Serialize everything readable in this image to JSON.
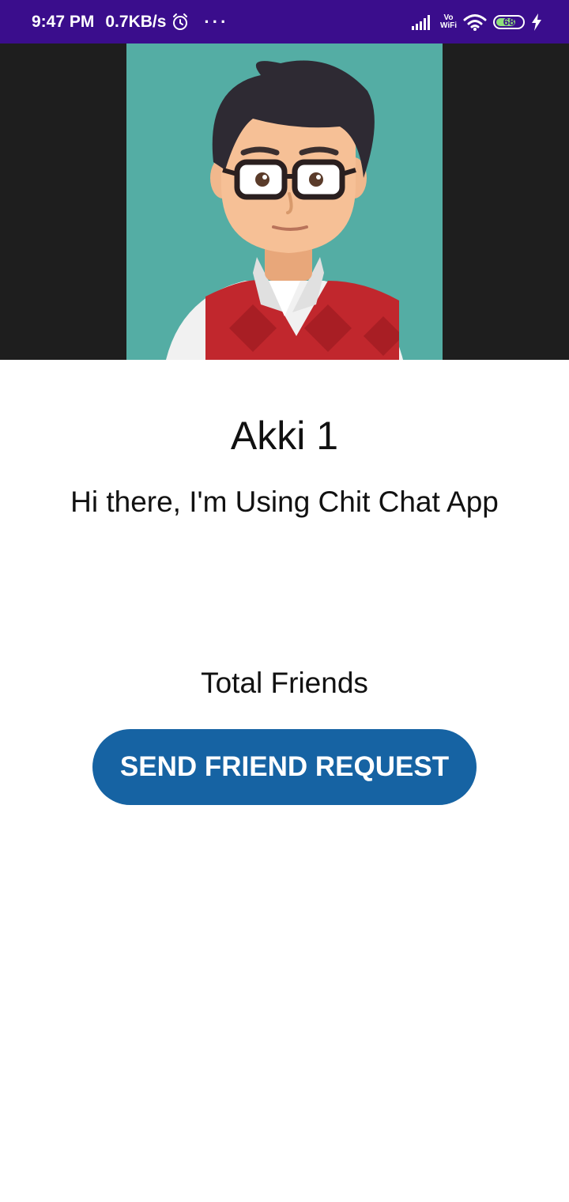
{
  "status_bar": {
    "time": "9:47 PM",
    "speed": "0.7KB/s",
    "more": "···",
    "vowifi_top": "Vo",
    "vowifi_bottom": "WiFi",
    "battery": "68",
    "icons": [
      "alarm-icon",
      "signal-icon",
      "vowifi-icon",
      "wifi-icon",
      "battery-icon",
      "charging-icon"
    ]
  },
  "profile": {
    "name": "Akki 1",
    "status": "Hi there, I'm Using Chit Chat App",
    "total_friends_label": "Total Friends",
    "send_request_label": "SEND FRIEND REQUEST"
  },
  "colors": {
    "status_bar": "#3a0d8c",
    "image_background": "#1e1e1e",
    "avatar_background": "#54ada4",
    "button": "#1663a3"
  }
}
